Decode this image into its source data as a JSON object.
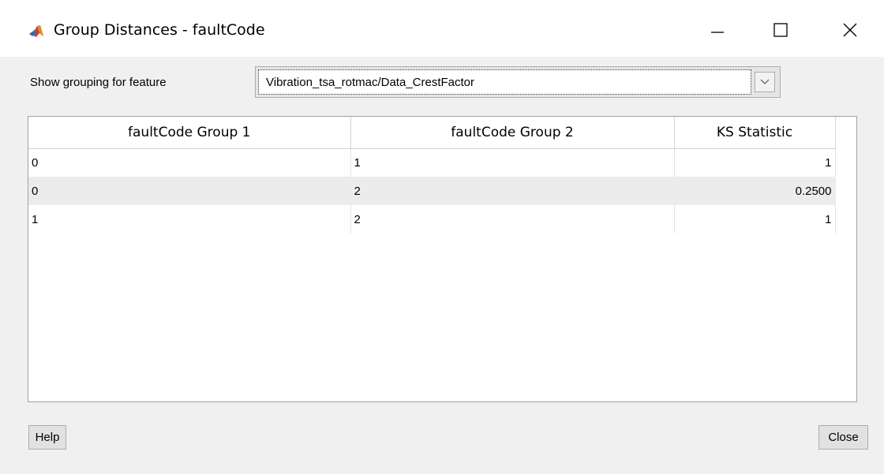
{
  "window": {
    "title": "Group Distances - faultCode",
    "app_icon": "matlab-icon",
    "controls": [
      "minimize-icon",
      "maximize-icon",
      "close-icon"
    ]
  },
  "feature": {
    "label": "Show grouping for feature",
    "selected": "Vibration_tsa_rotmac/Data_CrestFactor"
  },
  "table": {
    "columns": [
      "faultCode Group 1",
      "faultCode Group 2",
      "KS Statistic"
    ],
    "rows": [
      [
        "0",
        "1",
        "1"
      ],
      [
        "0",
        "2",
        "0.2500"
      ],
      [
        "1",
        "2",
        "1"
      ]
    ]
  },
  "buttons": {
    "help": "Help",
    "close": "Close"
  }
}
